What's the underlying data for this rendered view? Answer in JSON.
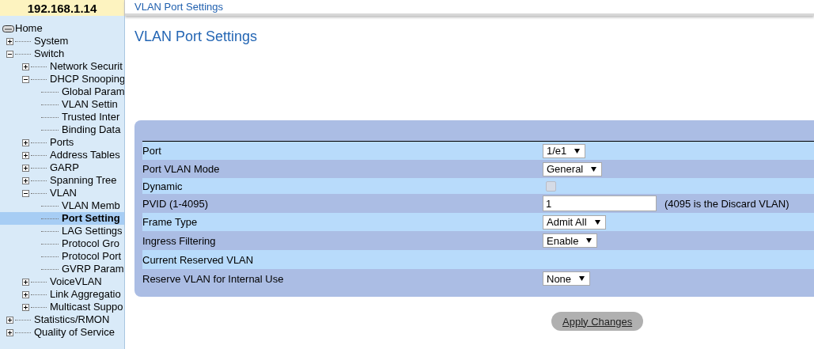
{
  "header": {
    "address": "192.168.1.14",
    "breadcrumb": "VLAN Port Settings"
  },
  "tree": [
    {
      "label": "Home",
      "kind": "root",
      "selected": false,
      "children": [
        {
          "label": "System",
          "kind": "branch",
          "expanded": false,
          "selected": false
        },
        {
          "label": "Switch",
          "kind": "branch",
          "expanded": true,
          "selected": false,
          "children": [
            {
              "label": "Network Securit",
              "kind": "branch",
              "expanded": false,
              "selected": false
            },
            {
              "label": "DHCP Snooping",
              "kind": "branch",
              "expanded": true,
              "selected": false,
              "children": [
                {
                  "label": "Global Param",
                  "kind": "leaf",
                  "selected": false
                },
                {
                  "label": "VLAN Settin",
                  "kind": "leaf",
                  "selected": false
                },
                {
                  "label": "Trusted Inter",
                  "kind": "leaf",
                  "selected": false
                },
                {
                  "label": "Binding Data",
                  "kind": "leaf",
                  "selected": false
                }
              ]
            },
            {
              "label": "Ports",
              "kind": "branch",
              "expanded": false,
              "selected": false
            },
            {
              "label": "Address Tables",
              "kind": "branch",
              "expanded": false,
              "selected": false
            },
            {
              "label": "GARP",
              "kind": "branch",
              "expanded": false,
              "selected": false
            },
            {
              "label": "Spanning Tree",
              "kind": "branch",
              "expanded": false,
              "selected": false
            },
            {
              "label": "VLAN",
              "kind": "branch",
              "expanded": true,
              "selected": false,
              "children": [
                {
                  "label": "VLAN Memb",
                  "kind": "leaf",
                  "selected": false
                },
                {
                  "label": "Port Setting",
                  "kind": "leaf",
                  "selected": true
                },
                {
                  "label": "LAG Settings",
                  "kind": "leaf",
                  "selected": false
                },
                {
                  "label": "Protocol Gro",
                  "kind": "leaf",
                  "selected": false
                },
                {
                  "label": "Protocol Port",
                  "kind": "leaf",
                  "selected": false
                },
                {
                  "label": "GVRP Param",
                  "kind": "leaf",
                  "selected": false
                }
              ]
            },
            {
              "label": "VoiceVLAN",
              "kind": "branch",
              "expanded": false,
              "selected": false
            },
            {
              "label": "Link Aggregatio",
              "kind": "branch",
              "expanded": false,
              "selected": false
            },
            {
              "label": "Multicast Suppo",
              "kind": "branch",
              "expanded": false,
              "selected": false
            }
          ]
        },
        {
          "label": "Statistics/RMON",
          "kind": "branch",
          "expanded": false,
          "selected": false
        },
        {
          "label": "Quality of Service",
          "kind": "branch",
          "expanded": false,
          "selected": false
        }
      ]
    }
  ],
  "title": "VLAN Port Settings",
  "settings": [
    {
      "label": "Port",
      "kind": "select",
      "value": "1/e1"
    },
    {
      "label": "Port VLAN Mode",
      "kind": "select",
      "value": "General"
    },
    {
      "label": "Dynamic",
      "kind": "checkbox",
      "checked": false,
      "disabled": true
    },
    {
      "label": "PVID (1-4095)",
      "kind": "text",
      "value": "1",
      "note": "(4095 is the Discard VLAN)"
    },
    {
      "label": "Frame Type",
      "kind": "select",
      "value": "Admit All"
    },
    {
      "label": "Ingress Filtering",
      "kind": "select",
      "value": "Enable"
    },
    {
      "label": "Current Reserved VLAN",
      "kind": "none"
    },
    {
      "label": "Reserve VLAN for Internal Use",
      "kind": "select",
      "value": "None"
    }
  ],
  "apply_button": "Apply Changes"
}
